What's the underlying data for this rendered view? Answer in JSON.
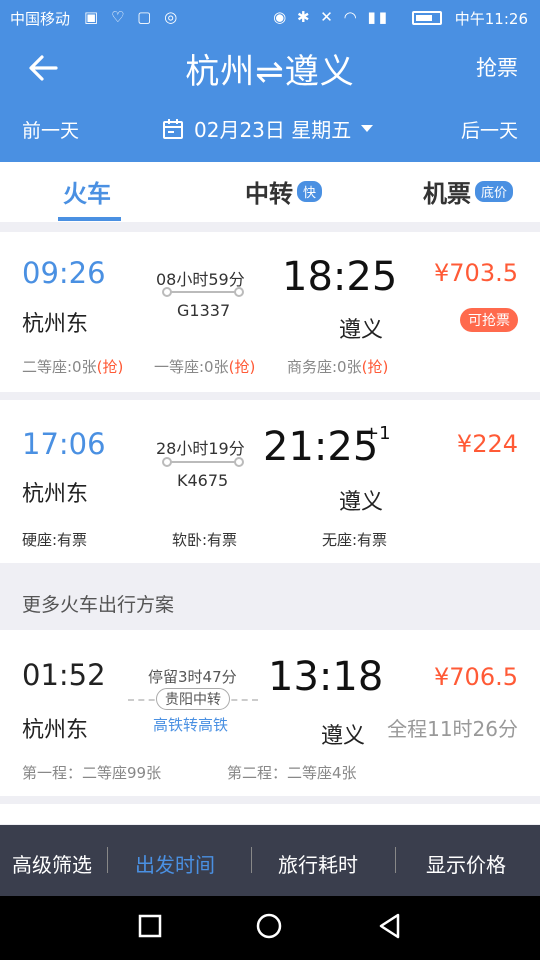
{
  "status_bar": {
    "carrier": "中国移动",
    "time": "中午11:26",
    "icons_left": [
      "notification-icon",
      "health-icon",
      "message-icon",
      "wechat-icon"
    ],
    "icons_right": [
      "vibrate-icon",
      "bluetooth-icon",
      "mute-icon",
      "wifi-icon",
      "signal-icon",
      "battery-icon"
    ]
  },
  "header": {
    "title": "杭州⇌遵义",
    "grab_label": "抢票",
    "prev_day": "前一天",
    "next_day": "后一天",
    "date": "02月23日 星期五"
  },
  "tabs": [
    {
      "label": "火车",
      "badge": "",
      "active": true
    },
    {
      "label": "中转",
      "badge": "快",
      "active": false
    },
    {
      "label": "机票",
      "badge": "底价",
      "active": false
    }
  ],
  "trains": [
    {
      "dep_time": "09:26",
      "dep_station": "杭州东",
      "duration": "08小时59分",
      "train_no": "G1337",
      "arr_time": "18:25",
      "arr_station": "遵义",
      "next_day_mark": "",
      "price": "¥703.5",
      "badge": "可抢票",
      "seats": [
        {
          "label": "二等座:0张",
          "grab": "(抢)"
        },
        {
          "label": "一等座:0张",
          "grab": "(抢)"
        },
        {
          "label": "商务座:0张",
          "grab": "(抢)"
        }
      ]
    },
    {
      "dep_time": "17:06",
      "dep_station": "杭州东",
      "duration": "28小时19分",
      "train_no": "K4675",
      "arr_time": "21:25",
      "arr_station": "遵义",
      "next_day_mark": "+1",
      "price": "¥224",
      "badge": "",
      "seats": [
        {
          "label": "硬座:有票",
          "grab": ""
        },
        {
          "label": "软卧:有票",
          "grab": ""
        },
        {
          "label": "无座:有票",
          "grab": ""
        }
      ]
    }
  ],
  "more_section_title": "更多火车出行方案",
  "transfer_plan": {
    "dep_time": "01:52",
    "dep_station": "杭州东",
    "stay": "停留3时47分",
    "transfer_city": "贵阳中转",
    "transfer_type": "高铁转高铁",
    "arr_time": "13:18",
    "arr_station": "遵义",
    "price": "¥706.5",
    "total_time": "全程11时26分",
    "leg1": "第一程：二等座99张",
    "leg2": "第二程：二等座4张"
  },
  "filters": [
    {
      "label": "高级筛选",
      "active": false
    },
    {
      "label": "出发时间",
      "active": true
    },
    {
      "label": "旅行耗时",
      "active": false
    },
    {
      "label": "显示价格",
      "active": false
    }
  ],
  "colors": {
    "brand": "#4a90e2",
    "price": "#ff5a36",
    "filter_bar": "#3a3e4d"
  }
}
